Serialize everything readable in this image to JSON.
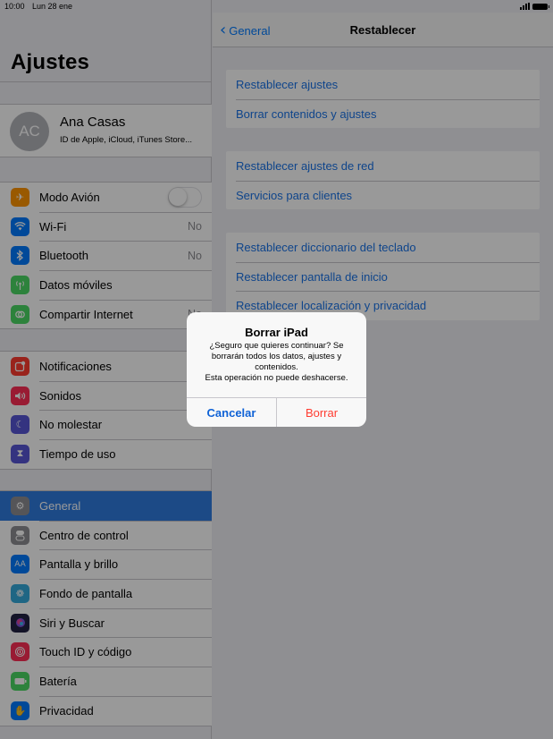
{
  "status": {
    "time": "10:00",
    "date": "Lun 28 ene"
  },
  "sidebar": {
    "title": "Ajustes",
    "profile": {
      "initials": "AC",
      "name": "Ana Casas",
      "subtitle": "ID de Apple, iCloud, iTunes Store..."
    },
    "group1": [
      {
        "label": "Modo Avión",
        "icon": "airplane-icon",
        "color": "#ff9500"
      },
      {
        "label": "Wi-Fi",
        "value": "No",
        "icon": "wifi-icon",
        "color": "#007aff"
      },
      {
        "label": "Bluetooth",
        "value": "No",
        "icon": "bluetooth-icon",
        "color": "#007aff"
      },
      {
        "label": "Datos móviles",
        "icon": "antenna-icon",
        "color": "#4cd964"
      },
      {
        "label": "Compartir Internet",
        "value": "No",
        "icon": "hotspot-icon",
        "color": "#4cd964"
      }
    ],
    "group2": [
      {
        "label": "Notificaciones",
        "icon": "notifications-icon",
        "color": "#ff3b30"
      },
      {
        "label": "Sonidos",
        "icon": "speaker-icon",
        "color": "#ff2d55"
      },
      {
        "label": "No molestar",
        "icon": "moon-icon",
        "color": "#5856d6"
      },
      {
        "label": "Tiempo de uso",
        "icon": "hourglass-icon",
        "color": "#5856d6"
      }
    ],
    "group3": [
      {
        "label": "General",
        "icon": "gear-icon",
        "color": "#8e8e93"
      },
      {
        "label": "Centro de control",
        "icon": "switches-icon",
        "color": "#8e8e93"
      },
      {
        "label": "Pantalla y brillo",
        "icon": "text-size-icon",
        "color": "#007aff"
      },
      {
        "label": "Fondo de pantalla",
        "icon": "flower-icon",
        "color": "#34aadc"
      },
      {
        "label": "Siri y Buscar",
        "icon": "siri-icon",
        "color": "#222244"
      },
      {
        "label": "Touch ID y código",
        "icon": "fingerprint-icon",
        "color": "#ff2d55"
      },
      {
        "label": "Batería",
        "icon": "battery-icon",
        "color": "#4cd964"
      },
      {
        "label": "Privacidad",
        "icon": "hand-icon",
        "color": "#007aff"
      }
    ]
  },
  "detail": {
    "back_label": "General",
    "title": "Restablecer",
    "group1": [
      "Restablecer ajustes",
      "Borrar contenidos y ajustes"
    ],
    "group2": [
      "Restablecer ajustes de red",
      "Servicios para clientes"
    ],
    "group3": [
      "Restablecer diccionario del teclado",
      "Restablecer pantalla de inicio",
      "Restablecer localización y privacidad"
    ]
  },
  "alert": {
    "title": "Borrar iPad",
    "message_line1": "¿Seguro que quieres continuar? Se",
    "message_line2": "borrarán todos los datos, ajustes y",
    "message_line3": "contenidos.",
    "message_line4": "Esta operación no puede deshacerse.",
    "cancel_label": "Cancelar",
    "confirm_label": "Borrar"
  }
}
